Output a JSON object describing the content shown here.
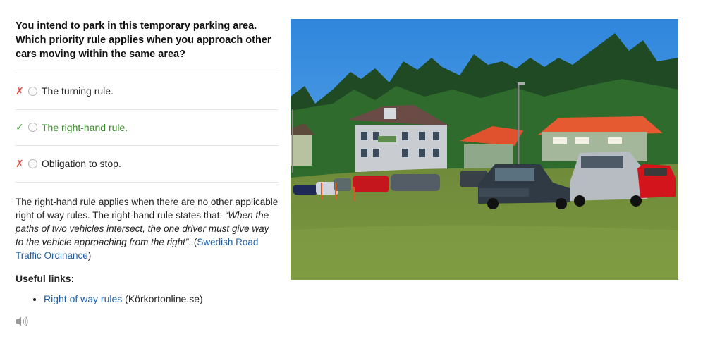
{
  "question": "You intend to park in this temporary parking area. Which priority rule applies when you approach other cars moving within the same area?",
  "answers": [
    {
      "mark": "✗",
      "label": "The turning rule.",
      "correct": false
    },
    {
      "mark": "✓",
      "label": "The right-hand rule.",
      "correct": true
    },
    {
      "mark": "✗",
      "label": "Obligation to stop.",
      "correct": false
    }
  ],
  "explanation": {
    "intro": "The right-hand rule applies when there are no other applicable right of way rules. The right-hand rule states that: ",
    "quote": "“When the paths of two vehicles intersect, the one driver must give way to the vehicle approaching from the right”",
    "after_quote": ". (",
    "source_link": "Swedish Road Traffic Ordinance",
    "closing": ")"
  },
  "useful_links_heading": "Useful links:",
  "links": [
    {
      "text": "Right of way rules",
      "suffix": " (Körkortonline.se)"
    }
  ],
  "icons": {
    "wrong": "cross-mark-icon",
    "right": "check-mark-icon",
    "audio": "speaker-icon"
  },
  "colors": {
    "wrong": "#e0463c",
    "right": "#3c9a3c",
    "link": "#1f5ea8"
  }
}
